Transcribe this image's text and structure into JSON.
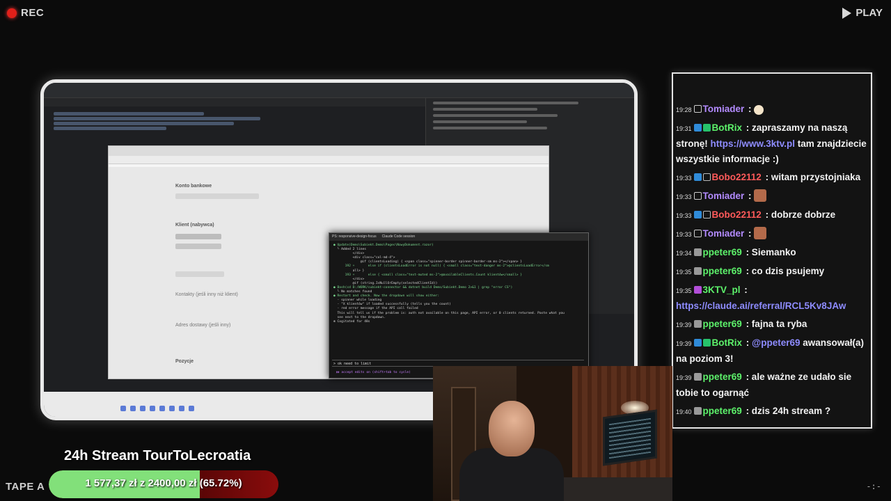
{
  "overlay": {
    "rec_label": "REC",
    "play_label": "PLAY",
    "tape_label": "TAPE A",
    "corner_mark": "-:-"
  },
  "terminal": {
    "tab1": "PS: responsive-design-focus",
    "tab2": "Claude Code session",
    "lines": [
      "● Update(Demo\\Subiekt.Demo\\Pages\\NowyDokument.razor)",
      "  └ Added 2 lines",
      "          </div>",
      "          <div class=\"col-md-4\">",
      "              @if (clientsLoading) { <span class=\"spinner-border spinner-border-sm ms-2\"></span> }",
      "      192 +       else if (clientsLoadError is not null) { <small class=\"text-danger ms-2\">@clientsLoadError</sm",
      "          all> }",
      "      193 +       else { <small class=\"text-muted ms-2\">@availableClients.Count klientów</small> }",
      "          </div>",
      "",
      "          @if (string.IsNullOrEmpty(selectedClientId))",
      "",
      "● Bash(cd D:/WORK/subiekt-connector && dotnet build Demo/Subiekt.Demo 2>&1 | grep \"error CS\")",
      "  └ No matches found",
      "",
      "● Restart and check. Now the dropdown will show either:",
      "  - spinner while loading",
      "  - \"X klientów\" if loaded successfully (tells you the count)",
      "  - red error message if the API call failed",
      "",
      "  This will tell us if the problem is: auth not available on this page, API error, or 0 clients returned. Paste what you",
      "  see next to the dropdown.",
      "",
      "✻ Cogitated for 48s"
    ],
    "input": "> ok need to limit",
    "mode": "⏵⏵ accept edits on (shift+tab to cycle)"
  },
  "browser_form": {
    "section1": "Konto bankowe",
    "section2": "Klient (nabywca)",
    "section3": "Kontakty (jeśli inny niż klient)",
    "section4": "Adres dostawy (jeśli inny)",
    "section5": "Pozycje"
  },
  "chat": {
    "messages": [
      {
        "time": "19:28",
        "user": "Tomiader",
        "user_color": "#b38bff",
        "icons": [
          "x"
        ],
        "text": ":",
        "emote": "hand"
      },
      {
        "time": "19:31",
        "user": "BotRix",
        "user_color": "#5df26b",
        "icons": [
          "mod",
          "ok"
        ],
        "text": ": zapraszamy na naszą stronę! ",
        "link": "https://www.3ktv.pl",
        "text2": " tam znajdziecie wszystkie informacje :)"
      },
      {
        "time": "19:33",
        "user": "Bobo22112",
        "user_color": "#ff5a5a",
        "icons": [
          "mod",
          "hex"
        ],
        "text": ": witam przystojniaka"
      },
      {
        "time": "19:33",
        "user": "Tomiader",
        "user_color": "#b38bff",
        "icons": [
          "x"
        ],
        "text": ":",
        "emote": "face"
      },
      {
        "time": "19:33",
        "user": "Bobo22112",
        "user_color": "#ff5a5a",
        "icons": [
          "mod",
          "hex"
        ],
        "text": ": dobrze dobrze"
      },
      {
        "time": "19:33",
        "user": "Tomiader",
        "user_color": "#b38bff",
        "icons": [
          "x"
        ],
        "text": ":",
        "emote": "face"
      },
      {
        "time": "19:34",
        "user": "ppeter69",
        "user_color": "#5df26b",
        "icons": [
          "hat"
        ],
        "text": ": Siemanko"
      },
      {
        "time": "19:35",
        "user": "ppeter69",
        "user_color": "#5df26b",
        "icons": [
          "hat"
        ],
        "text": ": co dzis psujemy"
      },
      {
        "time": "19:35",
        "user": "3KTV_pl",
        "user_color": "#5df26b",
        "icons": [
          "mic"
        ],
        "text": ":",
        "link": "https://claude.ai/referral/RCL5Kv8JAw"
      },
      {
        "time": "19:39",
        "user": "ppeter69",
        "user_color": "#5df26b",
        "icons": [
          "hat"
        ],
        "text": ": fajna ta ryba"
      },
      {
        "time": "19:39",
        "user": "BotRix",
        "user_color": "#5df26b",
        "icons": [
          "mod",
          "ok"
        ],
        "text": ": ",
        "link": "@ppeter69",
        "text2": " awansował(a) na poziom 3!"
      },
      {
        "time": "19:39",
        "user": "ppeter69",
        "user_color": "#5df26b",
        "icons": [
          "hat"
        ],
        "text": ": ale ważne ze udało sie tobie to ogarnąć"
      },
      {
        "time": "19:40",
        "user": "ppeter69",
        "user_color": "#5df26b",
        "icons": [
          "hat"
        ],
        "text": ": dzis 24h stream ?"
      }
    ]
  },
  "stream": {
    "title": "24h Stream TourToLecroatia",
    "goal_text": "1 577,37 zł  z  2400,00 zł  (65.72%)",
    "goal_fraction": 0.6572,
    "goal_color": "#82e07a"
  }
}
